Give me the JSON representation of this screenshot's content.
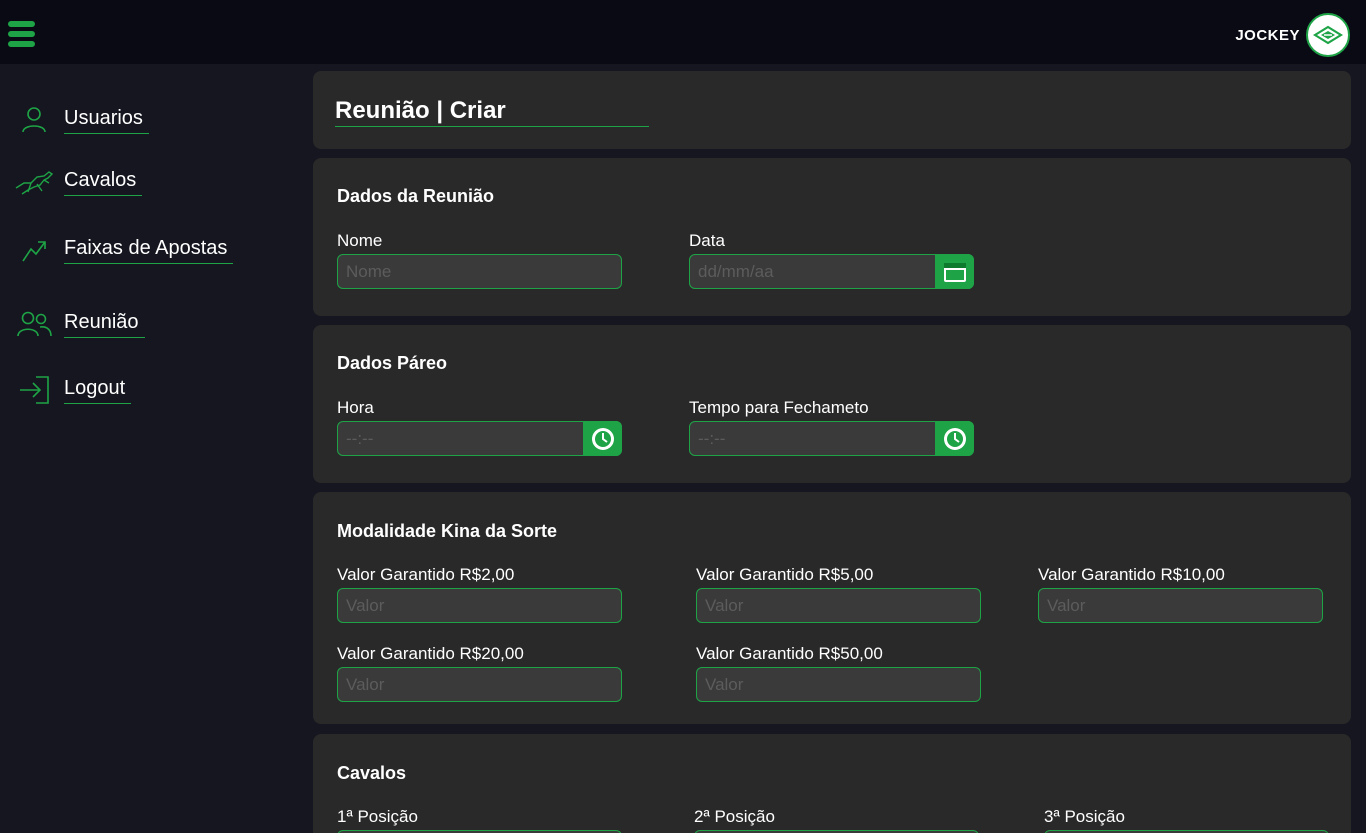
{
  "header": {
    "brand_name": "JOCKEY",
    "menu_icon": "hamburger-menu-icon",
    "logo_icon": "jockey-logo-icon"
  },
  "colors": {
    "accent": "#1ea446",
    "topbar_bg": "#0a0a15",
    "sidebar_bg": "#15161f",
    "card_bg": "#292929",
    "input_bg": "#3a3a3a",
    "placeholder": "#5c5c5c"
  },
  "sidebar": {
    "items": [
      {
        "label": "Usuarios",
        "icon": "user-icon"
      },
      {
        "label": "Cavalos",
        "icon": "horse-icon"
      },
      {
        "label": "Faixas de Apostas",
        "icon": "trend-chart-icon"
      },
      {
        "label": "Reunião",
        "icon": "group-users-icon"
      },
      {
        "label": "Logout",
        "icon": "logout-icon"
      }
    ]
  },
  "page": {
    "title": "Reunião | Criar"
  },
  "dados_reuniao": {
    "title": "Dados da Reunião",
    "nome_label": "Nome",
    "nome_placeholder": "Nome",
    "data_label": "Data",
    "data_placeholder": "dd/mm/aa",
    "data_icon": "calendar-icon"
  },
  "dados_pareo": {
    "title": "Dados Páreo",
    "hora_label": "Hora",
    "hora_placeholder": "--:--",
    "tempo_label": "Tempo para Fechameto",
    "tempo_placeholder": "--:--",
    "clock_icon": "clock-icon"
  },
  "modalidade": {
    "title": "Modalidade Kina da Sorte",
    "fields": [
      {
        "label": "Valor Garantido R$2,00",
        "placeholder": "Valor"
      },
      {
        "label": "Valor Garantido R$5,00",
        "placeholder": "Valor"
      },
      {
        "label": "Valor Garantido R$10,00",
        "placeholder": "Valor"
      },
      {
        "label": "Valor Garantido R$20,00",
        "placeholder": "Valor"
      },
      {
        "label": "Valor Garantido R$50,00",
        "placeholder": "Valor"
      }
    ]
  },
  "cavalos": {
    "title": "Cavalos",
    "positions": [
      {
        "label": "1ª Posição"
      },
      {
        "label": "2ª Posição"
      },
      {
        "label": "3ª Posição"
      }
    ]
  }
}
